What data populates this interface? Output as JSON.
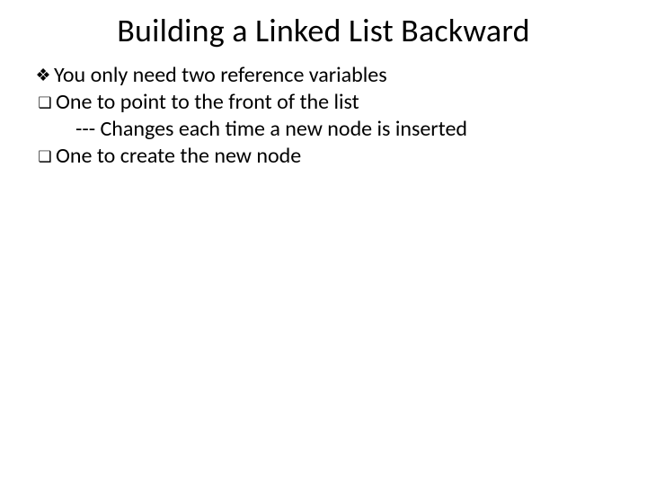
{
  "slide": {
    "title": "Building a Linked List Backward",
    "lines": {
      "l1": "You only need two reference variables",
      "l2": " One to point to the front of the list",
      "l3": "--- Changes each time a new node is inserted",
      "l4": " One to create the new node"
    },
    "bullets": {
      "diamond": "❖",
      "square": "❑"
    }
  }
}
